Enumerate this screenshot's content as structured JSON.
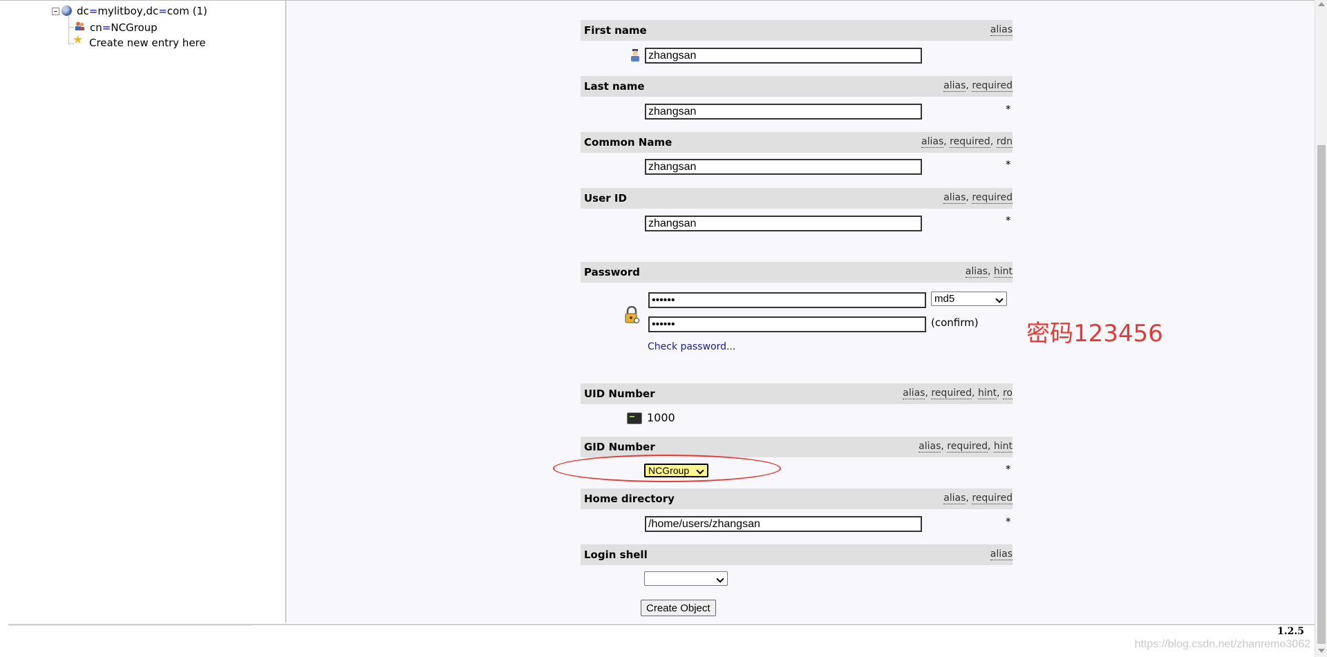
{
  "tree": {
    "root": {
      "dc1_key": "dc",
      "dc1_val": "mylitboy",
      "sep": ",",
      "dc2_key": "dc",
      "dc2_val": "com",
      "count": "(1)"
    },
    "child": {
      "key": "cn",
      "val": "NCGroup"
    },
    "create_entry": "Create new entry here"
  },
  "form": {
    "first_name": {
      "label": "First name",
      "links": [
        "alias"
      ],
      "value": "zhangsan"
    },
    "last_name": {
      "label": "Last name",
      "links": [
        "alias",
        "required"
      ],
      "value": "zhangsan",
      "required_mark": "*"
    },
    "common_name": {
      "label": "Common Name",
      "links": [
        "alias",
        "required",
        "rdn"
      ],
      "value": "zhangsan",
      "required_mark": "*"
    },
    "user_id": {
      "label": "User ID",
      "links": [
        "alias",
        "required"
      ],
      "value": "zhangsan",
      "required_mark": "*"
    },
    "password": {
      "label": "Password",
      "links": [
        "alias",
        "hint"
      ],
      "value": "••••••",
      "confirm_value": "••••••",
      "hash": "md5",
      "confirm_label": "(confirm)",
      "check_link": "Check password..."
    },
    "uid_number": {
      "label": "UID Number",
      "links": [
        "alias",
        "required",
        "hint",
        "ro"
      ],
      "value": "1000"
    },
    "gid_number": {
      "label": "GID Number",
      "links": [
        "alias",
        "required",
        "hint"
      ],
      "selected": "NCGroup",
      "required_mark": "*"
    },
    "home_directory": {
      "label": "Home directory",
      "links": [
        "alias",
        "required"
      ],
      "value": "/home/users/zhangsan",
      "required_mark": "*"
    },
    "login_shell": {
      "label": "Login shell",
      "links": [
        "alias"
      ],
      "selected": ""
    },
    "submit_label": "Create Object"
  },
  "annotation": {
    "text": "密码123456",
    "color": "#e53935"
  },
  "footer": {
    "version": "1.2.5",
    "watermark": "https://blog.csdn.net/zhanremo3062"
  }
}
